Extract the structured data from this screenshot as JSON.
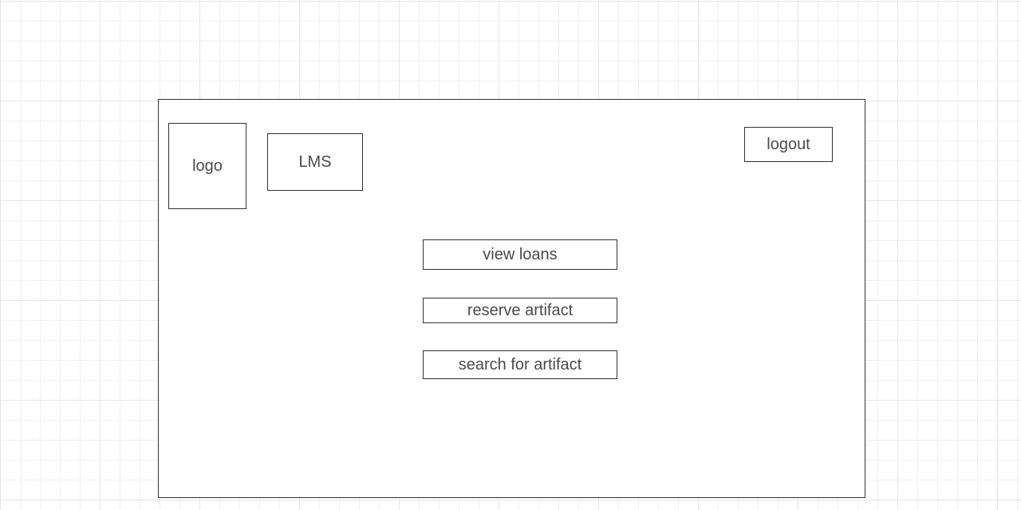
{
  "header": {
    "logo_label": "logo",
    "app_title": "LMS",
    "logout_label": "logout"
  },
  "actions": {
    "view_loans_label": "view loans",
    "reserve_artifact_label": "reserve artifact",
    "search_artifact_label": "search for artifact"
  }
}
